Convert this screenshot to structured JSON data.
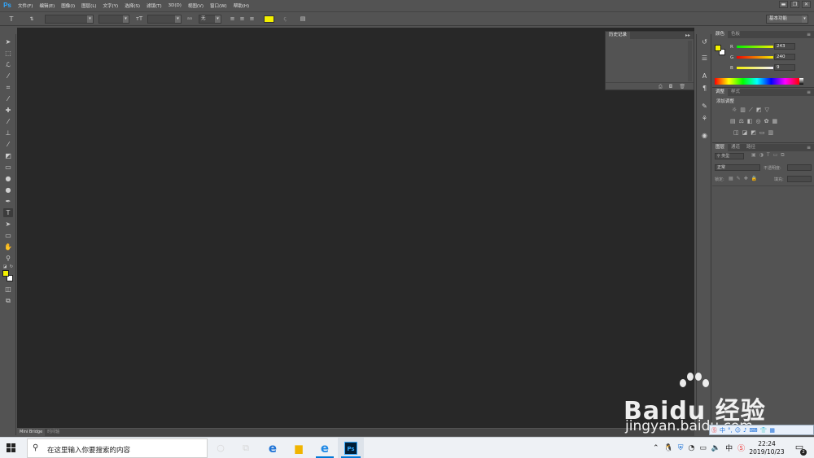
{
  "app": {
    "logo": "Ps"
  },
  "menubar": {
    "items": [
      "文件(F)",
      "编辑(E)",
      "图像(I)",
      "图层(L)",
      "文字(Y)",
      "选择(S)",
      "滤镜(T)",
      "3D(D)",
      "视图(V)",
      "窗口(W)",
      "帮助(H)"
    ]
  },
  "window_controls": {
    "minimize": "▬",
    "restore": "❐",
    "close": "✕"
  },
  "options_bar": {
    "tool_icon": "T",
    "aa_label": "aa",
    "aa_value": "无",
    "text_color": "#f3f000",
    "workspace": "基本功能"
  },
  "history_panel": {
    "tab": "历史记录",
    "menu": "▸▸"
  },
  "color_panel": {
    "tabs": [
      "颜色",
      "色板"
    ],
    "r_label": "R",
    "g_label": "G",
    "b_label": "B",
    "r": "243",
    "g": "240",
    "b": "9",
    "fg_color": "#f3f000",
    "bg_color": "#ffffff"
  },
  "adjust_panel": {
    "tabs": [
      "调整",
      "样式"
    ],
    "title": "添加调整"
  },
  "layers_panel": {
    "tabs": [
      "图层",
      "通道",
      "路径"
    ],
    "kind_label": "类型",
    "blend_mode": "正常",
    "opacity_label": "不透明度:",
    "lock_label": "锁定:",
    "fill_label": "填充:"
  },
  "mini_bridge": {
    "tabs": [
      "Mini Bridge",
      "时间轴"
    ]
  },
  "watermark": {
    "brand": "Bai",
    "brand2": "du",
    "cn": "经验",
    "sub": "jingyan.baidu.com"
  },
  "taskbar": {
    "search_placeholder": "在这里输入你要搜索的内容",
    "time": "22:24",
    "date": "2019/10/23",
    "notifications": "2"
  }
}
